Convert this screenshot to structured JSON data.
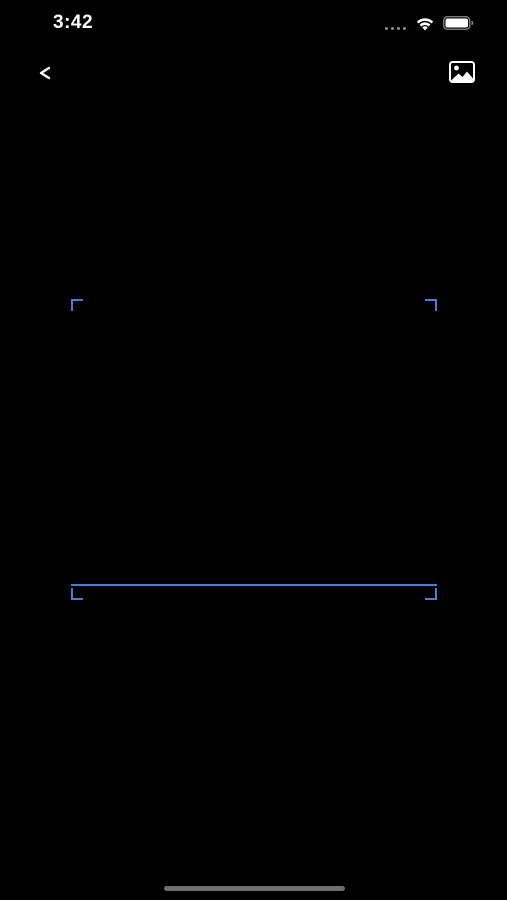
{
  "status_bar": {
    "time": "3:42"
  },
  "nav": {
    "back_label": "<",
    "back_icon": "chevron-left-icon",
    "gallery_icon": "photo-library-icon"
  },
  "scanner": {
    "accent_color": "#4a7fd0",
    "background_color": "#000000"
  }
}
